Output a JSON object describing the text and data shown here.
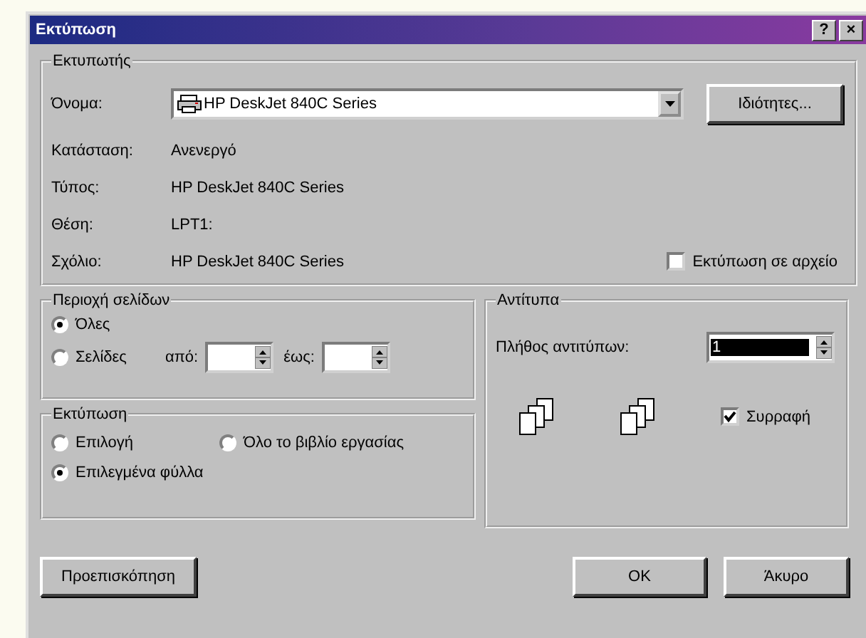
{
  "window": {
    "title": "Εκτύπωση",
    "help_button": "?",
    "close_button": "×"
  },
  "printer": {
    "label": "Εκτυπωτής",
    "name_label": "Όνομα:",
    "name": "HP DeskJet 840C Series",
    "properties_button": "Ιδιότητες...",
    "details": [
      {
        "label": "Κατάσταση:",
        "value": "Ανενεργό"
      },
      {
        "label": "Τύπος:",
        "value": "HP DeskJet 840C Series"
      },
      {
        "label": "Θέση:",
        "value": "LPT1:"
      },
      {
        "label": "Σχόλιο:",
        "value": "HP DeskJet 840C Series"
      }
    ],
    "print_to_file": {
      "label": "Εκτύπωση σε αρχείο",
      "checked": false
    }
  },
  "page_range": {
    "label": "Περιοχή σελίδων",
    "options": [
      {
        "label": "Όλες",
        "selected": true
      },
      {
        "label": "Σελίδες",
        "selected": false
      }
    ],
    "from_label": "από:",
    "to_label": "έως:"
  },
  "print_what": {
    "label": "Εκτύπωση",
    "options": [
      {
        "label": "Επιλογή",
        "selected": false
      },
      {
        "label": "Όλο το βιβλίο εργασίας",
        "selected": false
      },
      {
        "label": "Επιλεγμένα φύλλα",
        "selected": true
      }
    ]
  },
  "copies": {
    "label": "Αντίτυπα",
    "count_label": "Πλήθος αντιτύπων:",
    "count": "1",
    "collate": {
      "label": "Συρραφή",
      "checked": true
    }
  },
  "buttons": {
    "preview": "Προεπισκόπηση",
    "ok": "OK",
    "cancel": "Άκυρο"
  }
}
